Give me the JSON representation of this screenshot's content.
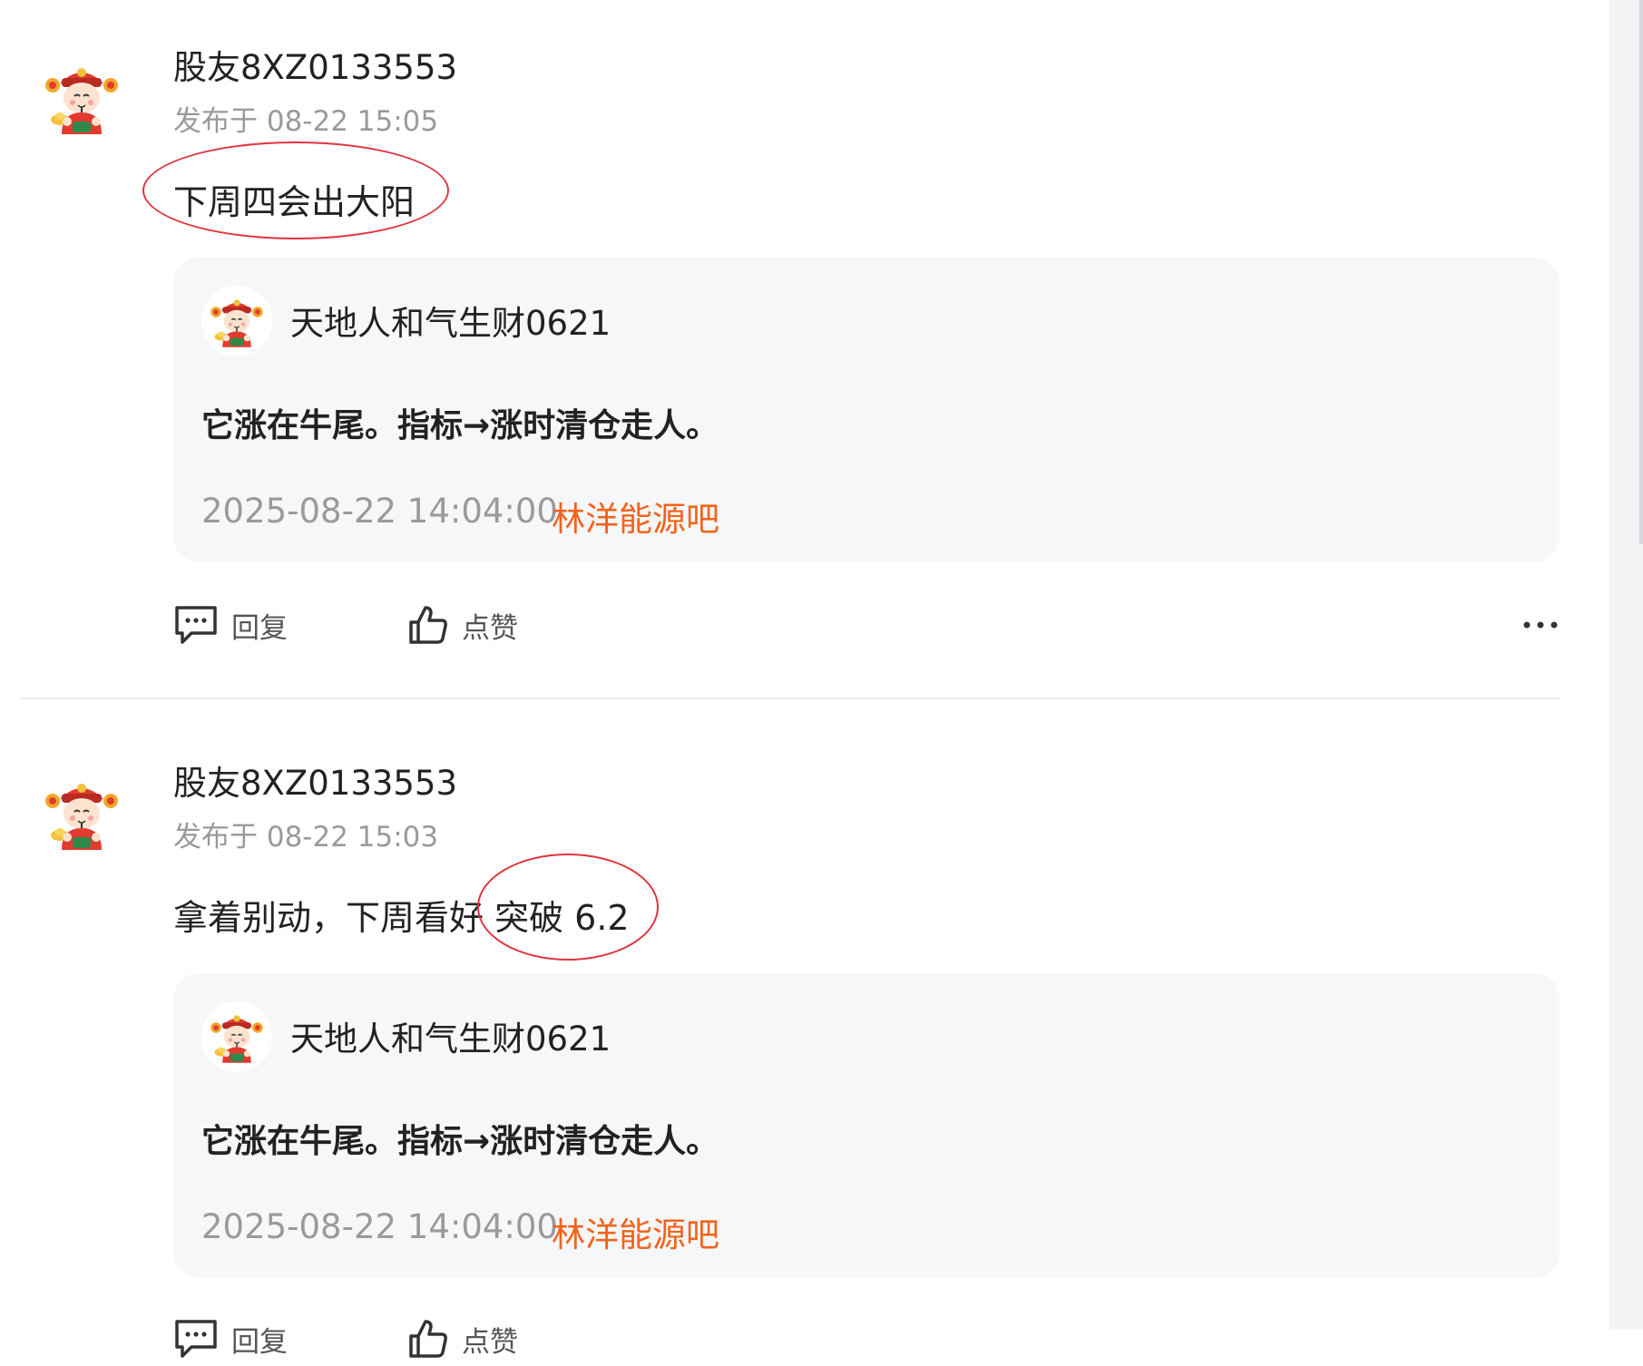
{
  "posts": [
    {
      "username": "股友8XZ0133553",
      "time": "发布于 08-22 15:05",
      "content": "下周四会出大阳",
      "quote": {
        "username": "天地人和气生财0621",
        "text": "它涨在牛尾。指标→涨时清仓走人。",
        "date": "2025-08-22 14:04:00",
        "forum": "林洋能源吧"
      },
      "reply_label": "回复",
      "like_label": "点赞"
    },
    {
      "username": "股友8XZ0133553",
      "time": "发布于 08-22 15:03",
      "content": "拿着别动，下周看好 突破 6.2",
      "quote": {
        "username": "天地人和气生财0621",
        "text": "它涨在牛尾。指标→涨时清仓走人。",
        "date": "2025-08-22 14:04:00",
        "forum": "林洋能源吧"
      },
      "reply_label": "回复",
      "like_label": "点赞"
    }
  ],
  "colors": {
    "forum_link": "#f2631c",
    "annotation_circle": "#e0343f",
    "muted_text": "#9a9a9a",
    "quote_bg": "#f6f7f9"
  },
  "icons": {
    "avatar": "caishen-avatar-icon",
    "reply": "comment-icon",
    "like": "thumbs-up-icon",
    "more": "more-dots-icon"
  }
}
